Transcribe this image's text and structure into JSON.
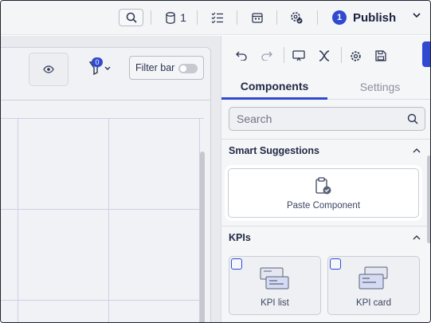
{
  "topbar": {
    "db_count": "1",
    "publish_badge": "1",
    "publish_label": "Publish"
  },
  "canvas": {
    "filter_count": "0",
    "filterbar_label": "Filter bar"
  },
  "panel": {
    "tabs": [
      {
        "label": "Components"
      },
      {
        "label": "Settings"
      }
    ],
    "search_placeholder": "Search",
    "sections": [
      {
        "title": "Smart Suggestions",
        "items": [
          {
            "label": "Paste Component"
          }
        ]
      },
      {
        "title": "KPIs",
        "items": [
          {
            "label": "KPI list"
          },
          {
            "label": "KPI card"
          }
        ]
      }
    ]
  },
  "colors": {
    "accent": "#2f49d1"
  }
}
